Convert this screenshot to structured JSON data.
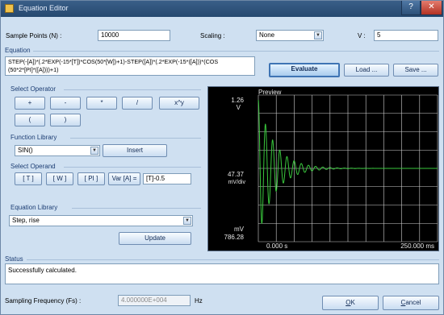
{
  "window": {
    "title": "Equation Editor",
    "help": "?",
    "close": "✕"
  },
  "settings": {
    "sample_points_label": "Sample Points (N) :",
    "sample_points_value": "10000",
    "scaling_label": "Scaling :",
    "scaling_value": "None",
    "v_label": "V :",
    "v_value": "5"
  },
  "equation": {
    "section_label": "Equation",
    "text_line1": "STEP(-[A])*(.2*EXP(-15*[T])*COS(50*[W])+1)-STEP([A])*(.2*EXP(-15*([A]))*(COS",
    "text_line2": "(50*2*[PI]*([A])))+1)",
    "evaluate": "Evaluate",
    "load": "Load ...",
    "save": "Save ..."
  },
  "operators": {
    "section_label": "Select Operator",
    "plus": "+",
    "minus": "-",
    "mult": "*",
    "div": "/",
    "pow": "x^y",
    "lparen": "(",
    "rparen": ")"
  },
  "function_library": {
    "section_label": "Function Library",
    "selected": "SIN()",
    "insert": "Insert"
  },
  "operand": {
    "section_label": "Select Operand",
    "t": "[ T ]",
    "w": "[ W ]",
    "pi": "[ PI ]",
    "var_a": "Var [A] =",
    "var_a_value": "[T]-0.5"
  },
  "equation_library": {
    "section_label": "Equation Library",
    "selected": "Step, rise",
    "update": "Update"
  },
  "preview": {
    "label": "Preview",
    "y_top_value": "1.26",
    "y_top_unit": "V",
    "y_mid_value": "47.37",
    "y_mid_unit": "mV/div",
    "y_bottom_unit": "mV",
    "y_bottom_value": "786.28",
    "x_start": "0.000 s",
    "x_end": "250.000 ms",
    "trace_color": "#39c83d"
  },
  "status": {
    "section_label": "Status",
    "message": "Successfully calculated."
  },
  "footer": {
    "sampling_label": "Sampling Frequency (Fs) :",
    "sampling_value": "4.000000E+004",
    "sampling_unit": "Hz",
    "ok_key": "O",
    "ok_rest": "K",
    "cancel_key": "C",
    "cancel_rest": "ancel"
  }
}
